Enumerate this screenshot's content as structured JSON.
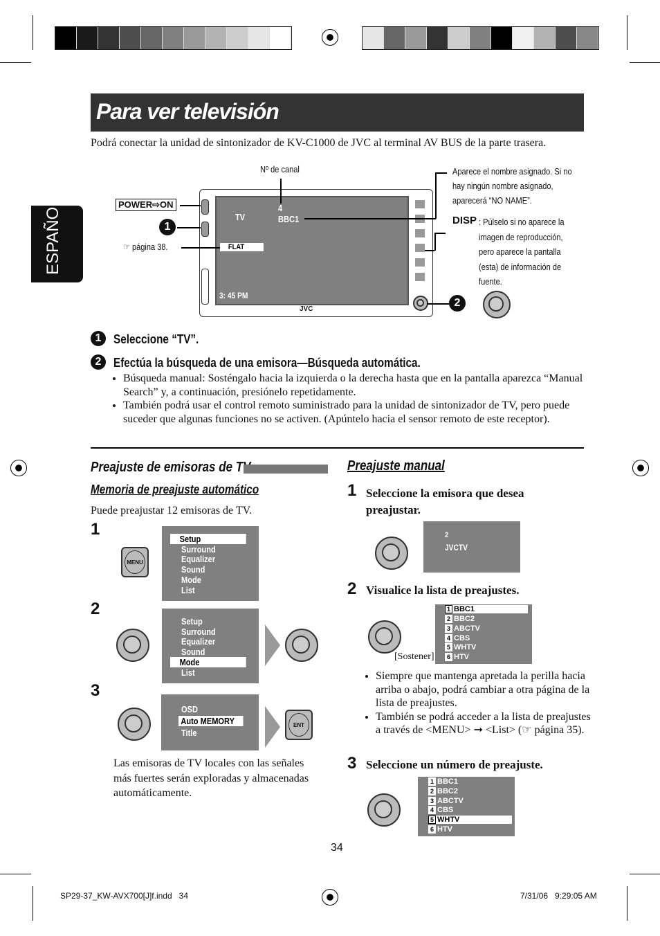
{
  "title": "Para ver televisión",
  "side_tab": "ESPAÑOL",
  "intro": "Podrá conectar la unidad de sintonizador de KV-C1000 de JVC al terminal AV BUS de la parte trasera.",
  "diagram": {
    "channel_label": "Nº de canal",
    "power_label": "POWER⇨ON",
    "page_ref": "☞ página 38.",
    "screen": {
      "source": "TV",
      "channel": "4",
      "name": "BBC1",
      "mode": "FLAT",
      "clock": "3: 45 PM",
      "brand": "JVC"
    },
    "name_note": "Aparece el nombre asignado. Si no hay ningún nombre asignado, aparecerá “NO NAME”.",
    "disp_key": "DISP",
    "disp_note": ": Púlselo si no aparece la imagen de reproducción, pero aparece la pantalla (esta) de información de fuente.",
    "markers": [
      "1",
      "2"
    ]
  },
  "steps": [
    {
      "n": "1",
      "text": "Seleccione “TV”."
    },
    {
      "n": "2",
      "text": "Efectúa la búsqueda de una emisora—Búsqueda automática."
    }
  ],
  "bullets": [
    "Búsqueda manual: Sosténgalo hacia la izquierda o la derecha  hasta que en la pantalla aparezca “Manual Search” y, a continuación, presiónelo repetidamente.",
    "También podrá usar el control remoto suministrado para la unidad de sintonizador de TV, pero puede suceder que algunas funciones no se activen. (Apúntelo hacia el sensor remoto de este receptor)."
  ],
  "left": {
    "heading": "Preajuste de emisoras de TV",
    "subheading": "Memoria de preajuste automático",
    "intro": "Puede preajustar 12 emisoras de TV.",
    "menu_button": "MENU",
    "ent_button": "ENT",
    "step_numbers": [
      "1",
      "2",
      "3"
    ],
    "menu_items": [
      "Setup",
      "Surround",
      "Equalizer",
      "Sound",
      "Mode",
      "List"
    ],
    "sub_items": [
      "OSD",
      "Auto MEMORY",
      "Title"
    ],
    "outro": "Las emisoras de TV locales con las señales más fuertes serán exploradas y almacenadas automáticamente."
  },
  "right": {
    "heading": "Preajuste manual",
    "steps": [
      {
        "n": "1",
        "text": "Seleccione la emisora que desea preajustar."
      },
      {
        "n": "2",
        "text": "Visualice la lista de preajustes."
      },
      {
        "n": "3",
        "text": "Seleccione un número de preajuste."
      }
    ],
    "screen1": {
      "channel": "2",
      "name": "JVCTV"
    },
    "hold_label": "[Sostener]",
    "presets": [
      {
        "n": "1",
        "name": "BBC1"
      },
      {
        "n": "2",
        "name": "BBC2"
      },
      {
        "n": "3",
        "name": "ABCTV"
      },
      {
        "n": "4",
        "name": "CBS"
      },
      {
        "n": "5",
        "name": "WHTV"
      },
      {
        "n": "6",
        "name": "HTV"
      }
    ],
    "bullets": [
      "Siempre que mantenga apretada la perilla hacia arriba o abajo, podrá cambiar a otra página de la lista de preajustes.",
      "También se podrá acceder a la lista de preajustes a través de <MENU> ➞ <List> (☞ página 35)."
    ]
  },
  "page_number": "34",
  "footer": {
    "file": "SP29-37_KW-AVX700[J]f.indd   34",
    "date": "7/31/06   9:29:05 AM"
  },
  "colors": {
    "title_bar": "#333333",
    "screen": "#808080",
    "tab": "#111111"
  }
}
